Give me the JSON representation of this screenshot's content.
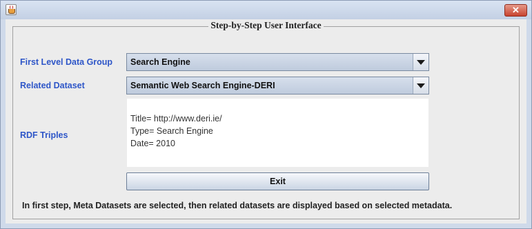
{
  "window": {
    "app_icon": "java-cup-icon",
    "close_glyph": "✕"
  },
  "panel": {
    "title": "Step-by-Step User Interface"
  },
  "first_level": {
    "label": "First Level Data Group",
    "selected": "Search Engine",
    "dropdown_icon": "chevron-down-icon"
  },
  "related": {
    "label": "Related Dataset",
    "selected": "Semantic Web Search Engine-DERI",
    "dropdown_icon": "chevron-down-icon"
  },
  "rdf": {
    "label": "RDF Triples",
    "lines": [
      "Title= http://www.deri.ie/",
      "Type= Search Engine",
      "Date= 2010"
    ]
  },
  "exit_label": "Exit",
  "footer_text": "In first step, Meta Datasets are selected, then related datasets are displayed based on selected metadata.",
  "colors": {
    "label_blue": "#2e56c8",
    "combo_bg": "#c9d3e3",
    "close_red": "#c7432f"
  }
}
